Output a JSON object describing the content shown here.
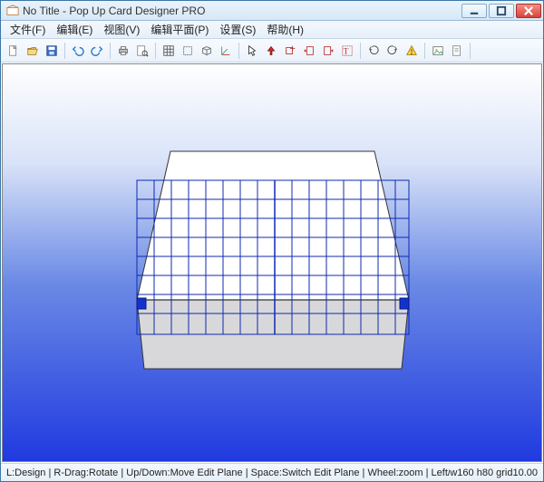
{
  "titlebar": {
    "title": "No Title - Pop Up Card Designer PRO"
  },
  "menubar": {
    "items": [
      "文件(F)",
      "编辑(E)",
      "视图(V)",
      "编辑平面(P)",
      "设置(S)",
      "帮助(H)"
    ]
  },
  "toolbar": {
    "icons": [
      "new-file-icon",
      "open-file-icon",
      "save-file-icon",
      "undo-icon",
      "redo-icon",
      "print-icon",
      "preview-icon",
      "grid-toggle-icon",
      "outline-icon",
      "box-icon",
      "axis-icon",
      "pointer-icon",
      "up-tool-icon",
      "add-plane-icon",
      "plane-left-icon",
      "plane-right-icon",
      "text-tool-icon",
      "rotate-left-icon",
      "rotate-right-icon",
      "warning-icon",
      "export-image-icon",
      "export-document-icon"
    ]
  },
  "viewport": {
    "grid_color": "#1028b0",
    "bg_gradient": [
      "#ffffff",
      "#203ae0"
    ]
  },
  "statusbar": {
    "hints": "L:Design | R-Drag:Rotate | Up/Down:Move Edit Plane | Space:Switch Edit Plane | Wheel:zoom | Left/Right Move Mirror",
    "dimensions": "w160 h80 grid10.00"
  }
}
